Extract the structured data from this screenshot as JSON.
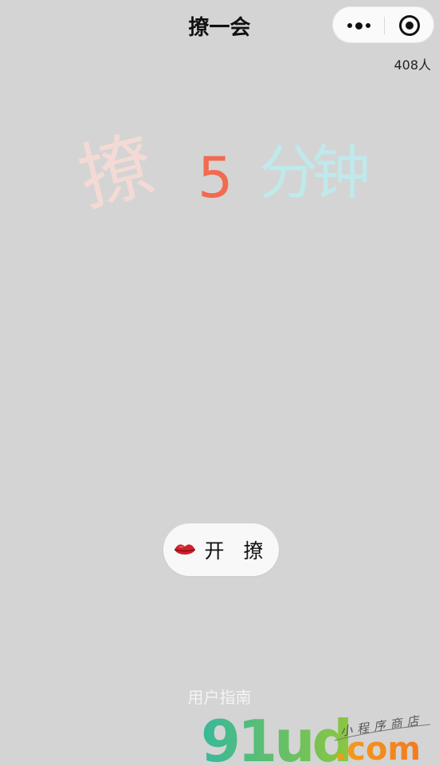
{
  "nav": {
    "title": "撩一会"
  },
  "online_count": "408人",
  "hero": {
    "char1": "撩",
    "number": "5",
    "chars2": "分钟"
  },
  "start_button": {
    "label": "开 撩"
  },
  "guide_link": "用户指南",
  "watermark": {
    "logo": "91ud",
    "domain": ".com",
    "tagline": "小程序商店"
  },
  "colors": {
    "background": "#d4d4d4",
    "accent_number": "#f26a4f",
    "hero_char1": "#f4dad5",
    "hero_chars2": "#bfe9ea"
  }
}
